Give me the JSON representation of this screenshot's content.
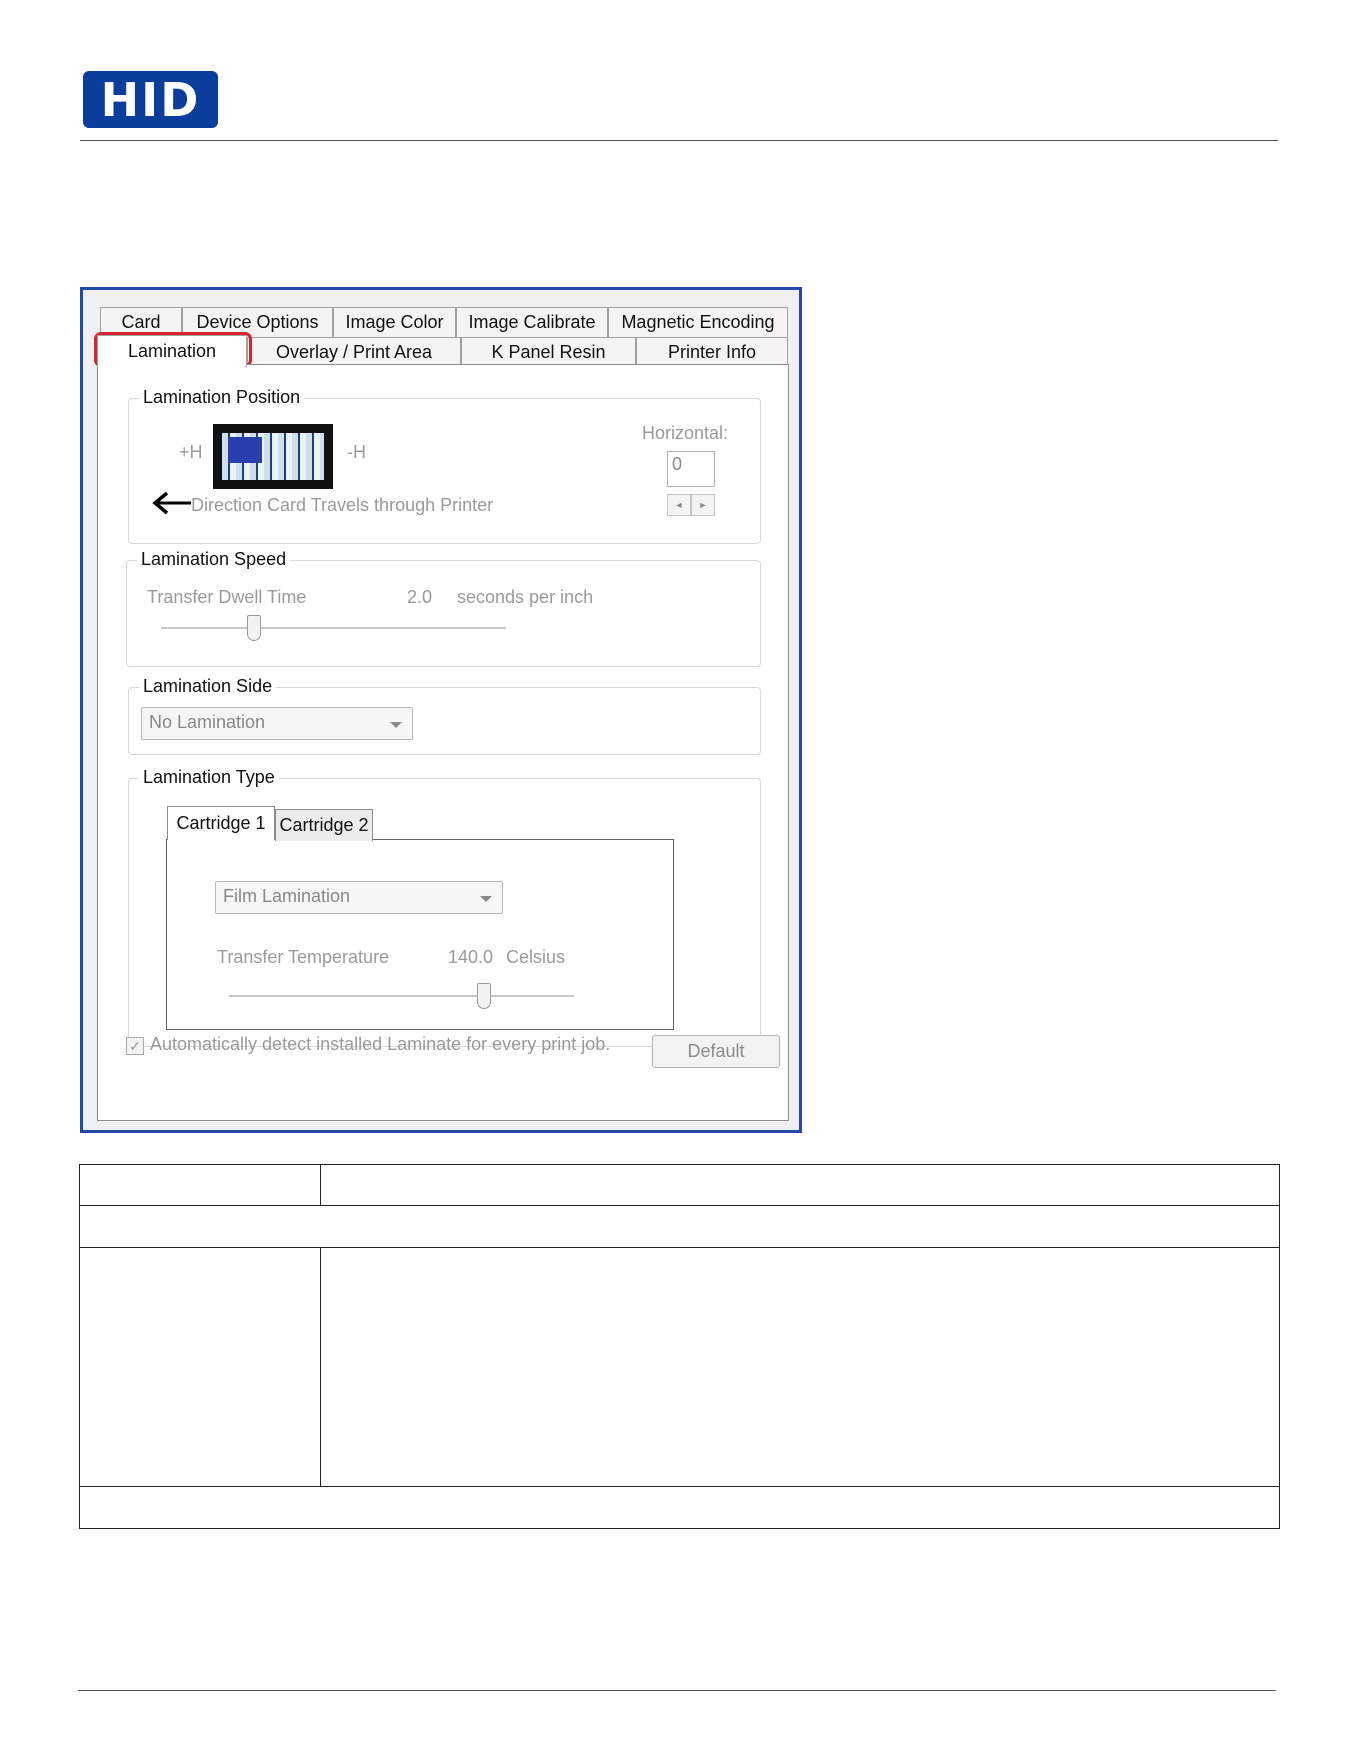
{
  "header": {
    "logo_text": "HID"
  },
  "dialog": {
    "tabs_row1": [
      "Card",
      "Device Options",
      "Image Color",
      "Image Calibrate",
      "Magnetic Encoding"
    ],
    "tabs_row2": [
      "Lamination",
      "Overlay / Print Area",
      "K Panel Resin",
      "Printer Info"
    ],
    "active_tab": "Lamination",
    "lamination_position": {
      "title": "Lamination Position",
      "plus_h": "+H",
      "minus_h": "-H",
      "direction_text": "Direction Card Travels through Printer",
      "horizontal_label": "Horizontal:",
      "horizontal_value": "0"
    },
    "lamination_speed": {
      "title": "Lamination Speed",
      "dwell_label": "Transfer Dwell Time",
      "dwell_value": "2.0",
      "dwell_unit": "seconds per inch",
      "slider_fraction": 0.27
    },
    "lamination_side": {
      "title": "Lamination Side",
      "selected": "No Lamination"
    },
    "lamination_type": {
      "title": "Lamination Type",
      "cartridge_tabs": [
        "Cartridge 1",
        "Cartridge 2"
      ],
      "active_cartridge": "Cartridge 1",
      "film_selected": "Film Lamination",
      "temp_label": "Transfer Temperature",
      "temp_value": "140.0",
      "temp_unit": "Celsius",
      "slider_fraction": 0.74
    },
    "auto_detect_label": "Automatically detect installed Laminate for every print job.",
    "auto_detect_checked": true,
    "default_button": "Default"
  }
}
